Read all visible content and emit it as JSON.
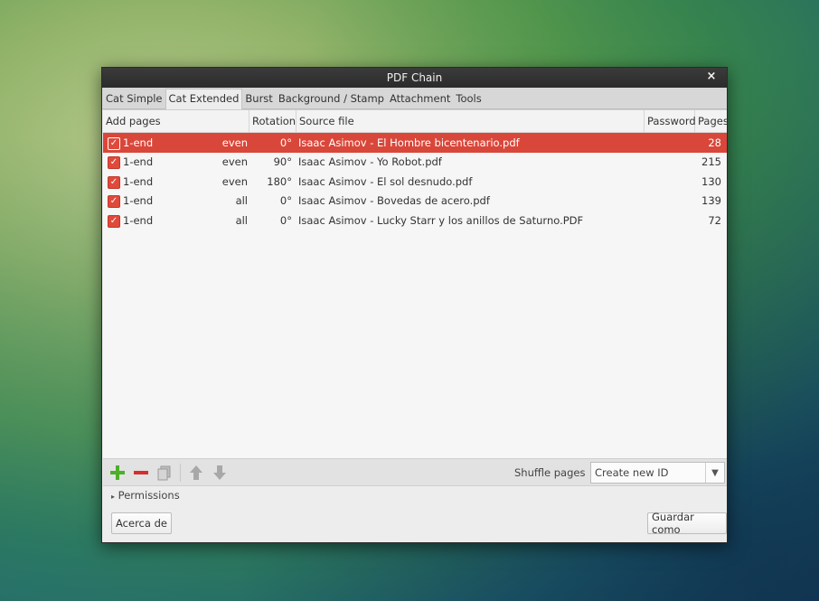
{
  "window": {
    "title": "PDF Chain",
    "close_label": "×"
  },
  "tabs": [
    {
      "label": "Cat Simple",
      "active": false
    },
    {
      "label": "Cat Extended",
      "active": true
    },
    {
      "label": "Burst",
      "active": false
    },
    {
      "label": "Background / Stamp",
      "active": false
    },
    {
      "label": "Attachment",
      "active": false
    },
    {
      "label": "Tools",
      "active": false
    }
  ],
  "table": {
    "columns": {
      "add_pages": "Add pages",
      "rotation": "Rotation",
      "source_file": "Source file",
      "password": "Password",
      "pages": "Pages"
    },
    "rows": [
      {
        "checked": true,
        "range": "1-end",
        "parity": "even",
        "rotation": "0°",
        "source": "Isaac Asimov - El Hombre bicentenario.pdf",
        "password": "",
        "pages": "28",
        "selected": true
      },
      {
        "checked": true,
        "range": "1-end",
        "parity": "even",
        "rotation": "90°",
        "source": "Isaac Asimov - Yo Robot.pdf",
        "password": "",
        "pages": "215",
        "selected": false
      },
      {
        "checked": true,
        "range": "1-end",
        "parity": "even",
        "rotation": "180°",
        "source": "Isaac Asimov - El sol desnudo.pdf",
        "password": "",
        "pages": "130",
        "selected": false
      },
      {
        "checked": true,
        "range": "1-end",
        "parity": "all",
        "rotation": "0°",
        "source": "Isaac Asimov - Bovedas de acero.pdf",
        "password": "",
        "pages": "139",
        "selected": false
      },
      {
        "checked": true,
        "range": "1-end",
        "parity": "all",
        "rotation": "0°",
        "source": "Isaac Asimov - Lucky Starr y los anillos de Saturno.PDF",
        "password": "",
        "pages": "72",
        "selected": false
      }
    ]
  },
  "toolbar": {
    "shuffle_label": "Shuffle pages",
    "id_combo_value": "Create new ID",
    "colors": {
      "add": "#4caf2a",
      "remove": "#d32f2f",
      "disabled": "#a8a8a8"
    }
  },
  "permissions": {
    "arrow": "▸",
    "label": "Permissions"
  },
  "buttons": {
    "about": "Acerca de",
    "save_as": "Guardar como"
  }
}
